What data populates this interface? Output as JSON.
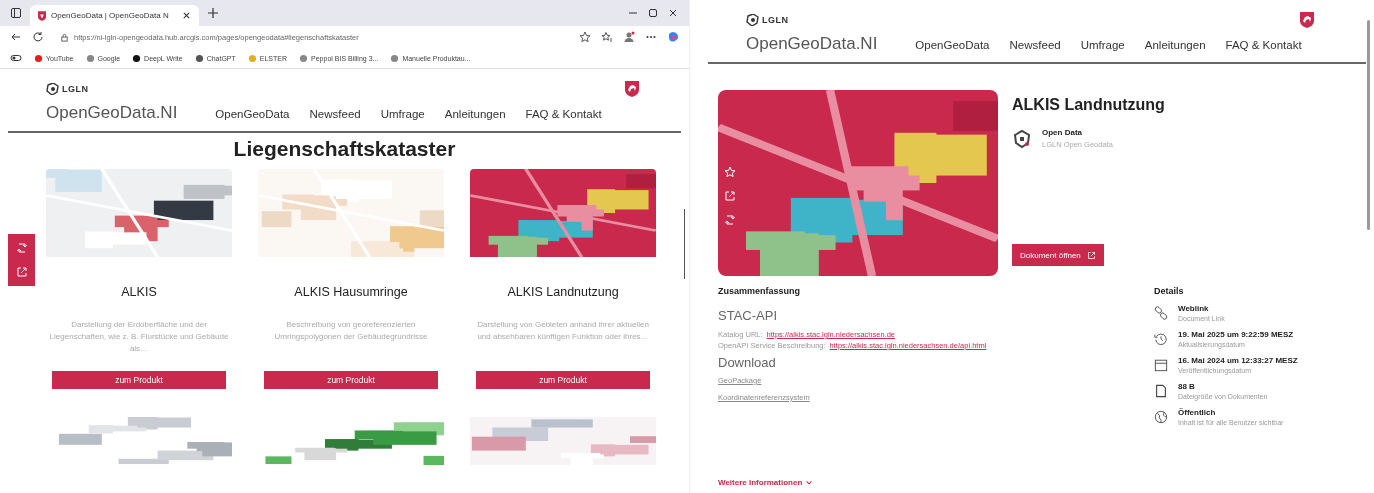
{
  "browser": {
    "tabs": [
      {
        "label": "OpenGeoData | OpenGeoData N",
        "selected": true
      }
    ],
    "url": "https://ni-lgln-opengeodata.hub.arcgis.com/pages/opengeodata#liegenschaftskataster",
    "bookmarks": [
      "YouTube",
      "Google",
      "DeepL Write",
      "ChatGPT",
      "ELSTER",
      "Peppol BIS Billing 3...",
      "Manuelle Produktau..."
    ]
  },
  "left_page": {
    "logo": "LGLN",
    "site_name": "OpenGeoData.NI",
    "nav": [
      "OpenGeoData",
      "Newsfeed",
      "Umfrage",
      "Anleitungen",
      "FAQ & Kontakt"
    ],
    "heading": "Liegenschaftskataster",
    "cards": [
      {
        "title": "ALKIS",
        "description": "Darstellung der Erdoberfläche und der Liegenschaften, wie z. B. Flurstücke und Gebäude als…",
        "button": "zum Produkt"
      },
      {
        "title": "ALKIS Hausumringe",
        "description": "Beschreibung von georeferenzierten Umringspolygonen der Gebäudegrundrisse",
        "button": "zum Produkt"
      },
      {
        "title": "ALKIS Landnutzung",
        "description": "Darstellung von Gebieten anhand ihrer aktuellen und absehbaren künftigen Funktion oder ihres…",
        "button": "zum Produkt"
      }
    ]
  },
  "right_page": {
    "logo": "LGLN",
    "site_name": "OpenGeoData.NI",
    "nav": [
      "OpenGeoData",
      "Newsfeed",
      "Umfrage",
      "Anleitungen",
      "FAQ & Kontakt"
    ],
    "title": "ALKIS Landnutzung",
    "publisher": {
      "name": "Open Data",
      "org": "LGLN Open Geodata"
    },
    "open_button": "Dokument öffnen",
    "summary": {
      "heading": "Zusammenfassung",
      "api_heading": "STAC-API",
      "lines": [
        {
          "label": "Katalog URL:",
          "link": "https://alkis.stac.lgln.niedersachsen.de"
        },
        {
          "label": "OpenAPI Service Beschreibung:",
          "link": "https://alkis.stac.lgln.niedersachsen.de/api.html"
        }
      ],
      "download_heading": "Download",
      "downloads": [
        "GeoPackage",
        "Koordinatenreferenzsystem"
      ]
    },
    "more": "Weitere Informationen",
    "details": {
      "heading": "Details",
      "items": [
        {
          "kind": "link",
          "title": "Weblink",
          "subtitle": "Document Link"
        },
        {
          "kind": "updated",
          "title": "19. Mai 2025 um 9:22:59 MESZ",
          "subtitle": "Aktualisierungsdatum"
        },
        {
          "kind": "published",
          "title": "16. Mai 2024 um 12:33:27 MESZ",
          "subtitle": "Veröffentlichungsdatum"
        },
        {
          "kind": "size",
          "title": "88 B",
          "subtitle": "Dateigröße von Dokumenten"
        },
        {
          "kind": "access",
          "title": "Öffentlich",
          "subtitle": "Inhalt ist für alle Benutzer sichtbar"
        }
      ]
    }
  }
}
